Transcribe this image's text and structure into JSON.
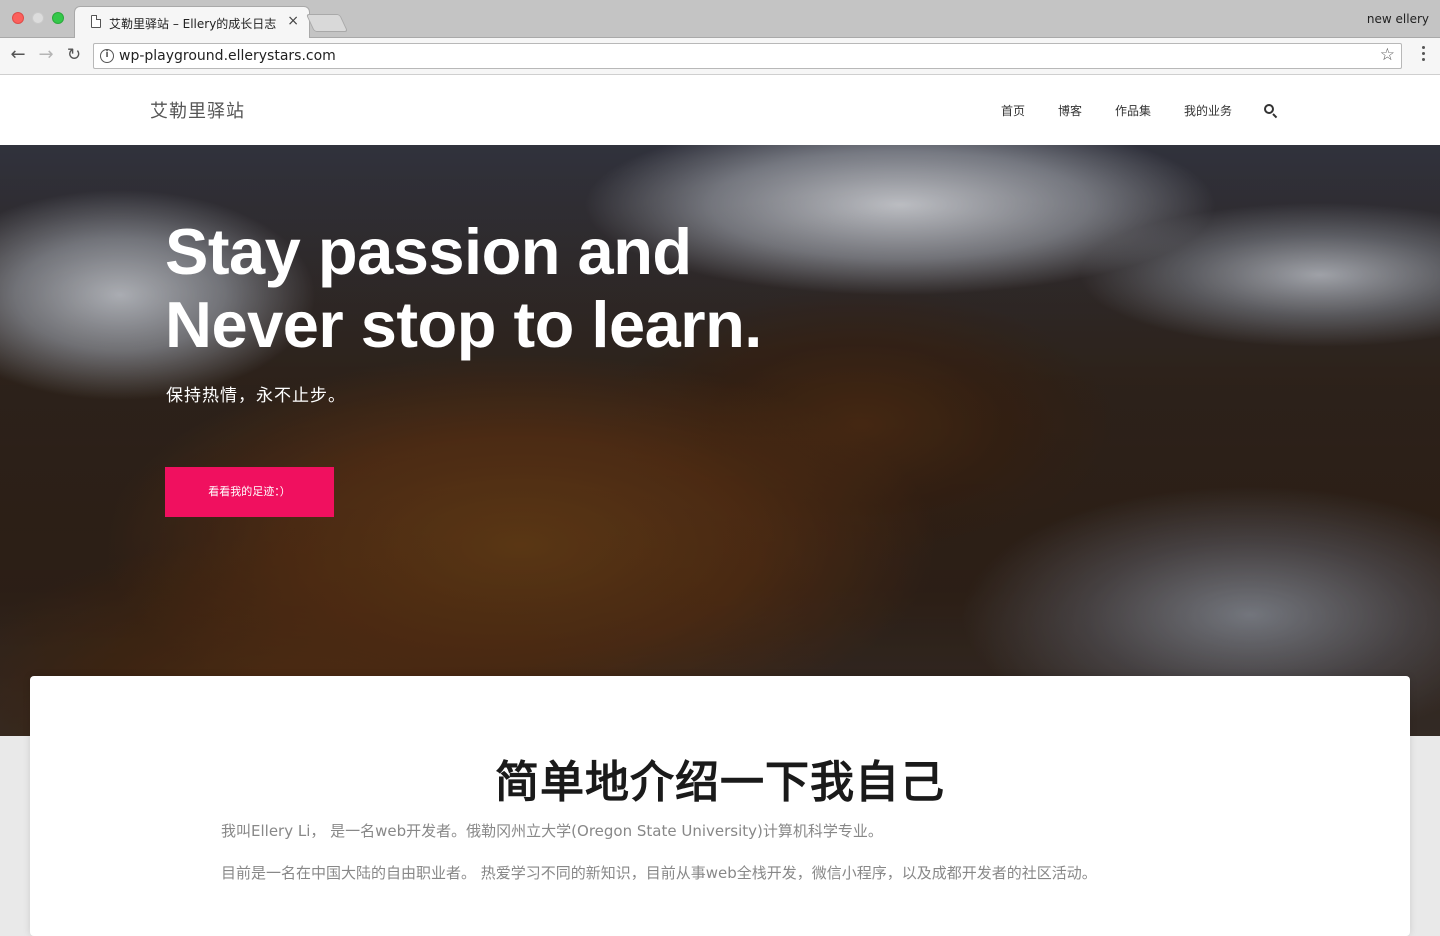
{
  "browser": {
    "tab_title": "艾勒里驿站 – Ellery的成长日志",
    "tab_close": "×",
    "profile_name": "new ellery",
    "url": "wp-playground.ellerystars.com",
    "icons": {
      "back": "arrow-left-icon",
      "forward": "arrow-right-icon",
      "reload": "reload-icon",
      "info": "info-icon",
      "bookmark": "star-icon",
      "menu": "vertical-dots-icon"
    }
  },
  "site": {
    "title": "艾勒里驿站",
    "nav": [
      {
        "label": "首页"
      },
      {
        "label": "博客"
      },
      {
        "label": "作品集"
      },
      {
        "label": "我的业务"
      }
    ],
    "search_icon": "search-icon"
  },
  "hero": {
    "heading_line1": "Stay passion and",
    "heading_line2": "Never stop to learn.",
    "subtitle": "保持热情，永不止步。",
    "cta_label": "看看我的足迹：）",
    "cta_color": "#f0105f"
  },
  "intro": {
    "title": "简单地介绍一下我自己",
    "paragraph1": "我叫Ellery Li， 是一名web开发者。俄勒冈州立大学(Oregon State University)计算机科学专业。",
    "paragraph2": "目前是一名在中国大陆的自由职业者。 热爱学习不同的新知识，目前从事web全栈开发，微信小程序，以及成都开发者的社区活动。"
  }
}
